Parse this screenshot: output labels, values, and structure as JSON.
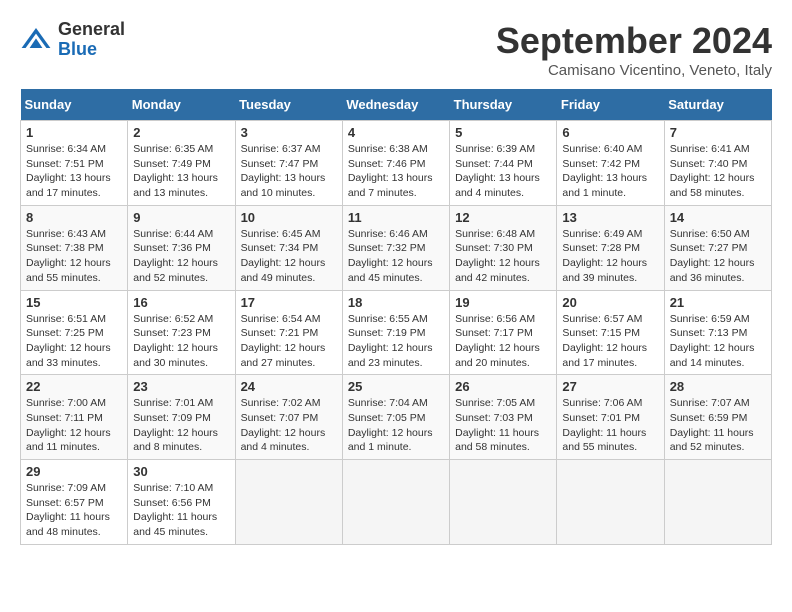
{
  "header": {
    "logo_general": "General",
    "logo_blue": "Blue",
    "month_title": "September 2024",
    "location": "Camisano Vicentino, Veneto, Italy"
  },
  "days_of_week": [
    "Sunday",
    "Monday",
    "Tuesday",
    "Wednesday",
    "Thursday",
    "Friday",
    "Saturday"
  ],
  "weeks": [
    [
      {
        "day": "1",
        "info": "Sunrise: 6:34 AM\nSunset: 7:51 PM\nDaylight: 13 hours and 17 minutes."
      },
      {
        "day": "2",
        "info": "Sunrise: 6:35 AM\nSunset: 7:49 PM\nDaylight: 13 hours and 13 minutes."
      },
      {
        "day": "3",
        "info": "Sunrise: 6:37 AM\nSunset: 7:47 PM\nDaylight: 13 hours and 10 minutes."
      },
      {
        "day": "4",
        "info": "Sunrise: 6:38 AM\nSunset: 7:46 PM\nDaylight: 13 hours and 7 minutes."
      },
      {
        "day": "5",
        "info": "Sunrise: 6:39 AM\nSunset: 7:44 PM\nDaylight: 13 hours and 4 minutes."
      },
      {
        "day": "6",
        "info": "Sunrise: 6:40 AM\nSunset: 7:42 PM\nDaylight: 13 hours and 1 minute."
      },
      {
        "day": "7",
        "info": "Sunrise: 6:41 AM\nSunset: 7:40 PM\nDaylight: 12 hours and 58 minutes."
      }
    ],
    [
      {
        "day": "8",
        "info": "Sunrise: 6:43 AM\nSunset: 7:38 PM\nDaylight: 12 hours and 55 minutes."
      },
      {
        "day": "9",
        "info": "Sunrise: 6:44 AM\nSunset: 7:36 PM\nDaylight: 12 hours and 52 minutes."
      },
      {
        "day": "10",
        "info": "Sunrise: 6:45 AM\nSunset: 7:34 PM\nDaylight: 12 hours and 49 minutes."
      },
      {
        "day": "11",
        "info": "Sunrise: 6:46 AM\nSunset: 7:32 PM\nDaylight: 12 hours and 45 minutes."
      },
      {
        "day": "12",
        "info": "Sunrise: 6:48 AM\nSunset: 7:30 PM\nDaylight: 12 hours and 42 minutes."
      },
      {
        "day": "13",
        "info": "Sunrise: 6:49 AM\nSunset: 7:28 PM\nDaylight: 12 hours and 39 minutes."
      },
      {
        "day": "14",
        "info": "Sunrise: 6:50 AM\nSunset: 7:27 PM\nDaylight: 12 hours and 36 minutes."
      }
    ],
    [
      {
        "day": "15",
        "info": "Sunrise: 6:51 AM\nSunset: 7:25 PM\nDaylight: 12 hours and 33 minutes."
      },
      {
        "day": "16",
        "info": "Sunrise: 6:52 AM\nSunset: 7:23 PM\nDaylight: 12 hours and 30 minutes."
      },
      {
        "day": "17",
        "info": "Sunrise: 6:54 AM\nSunset: 7:21 PM\nDaylight: 12 hours and 27 minutes."
      },
      {
        "day": "18",
        "info": "Sunrise: 6:55 AM\nSunset: 7:19 PM\nDaylight: 12 hours and 23 minutes."
      },
      {
        "day": "19",
        "info": "Sunrise: 6:56 AM\nSunset: 7:17 PM\nDaylight: 12 hours and 20 minutes."
      },
      {
        "day": "20",
        "info": "Sunrise: 6:57 AM\nSunset: 7:15 PM\nDaylight: 12 hours and 17 minutes."
      },
      {
        "day": "21",
        "info": "Sunrise: 6:59 AM\nSunset: 7:13 PM\nDaylight: 12 hours and 14 minutes."
      }
    ],
    [
      {
        "day": "22",
        "info": "Sunrise: 7:00 AM\nSunset: 7:11 PM\nDaylight: 12 hours and 11 minutes."
      },
      {
        "day": "23",
        "info": "Sunrise: 7:01 AM\nSunset: 7:09 PM\nDaylight: 12 hours and 8 minutes."
      },
      {
        "day": "24",
        "info": "Sunrise: 7:02 AM\nSunset: 7:07 PM\nDaylight: 12 hours and 4 minutes."
      },
      {
        "day": "25",
        "info": "Sunrise: 7:04 AM\nSunset: 7:05 PM\nDaylight: 12 hours and 1 minute."
      },
      {
        "day": "26",
        "info": "Sunrise: 7:05 AM\nSunset: 7:03 PM\nDaylight: 11 hours and 58 minutes."
      },
      {
        "day": "27",
        "info": "Sunrise: 7:06 AM\nSunset: 7:01 PM\nDaylight: 11 hours and 55 minutes."
      },
      {
        "day": "28",
        "info": "Sunrise: 7:07 AM\nSunset: 6:59 PM\nDaylight: 11 hours and 52 minutes."
      }
    ],
    [
      {
        "day": "29",
        "info": "Sunrise: 7:09 AM\nSunset: 6:57 PM\nDaylight: 11 hours and 48 minutes."
      },
      {
        "day": "30",
        "info": "Sunrise: 7:10 AM\nSunset: 6:56 PM\nDaylight: 11 hours and 45 minutes."
      },
      null,
      null,
      null,
      null,
      null
    ]
  ]
}
